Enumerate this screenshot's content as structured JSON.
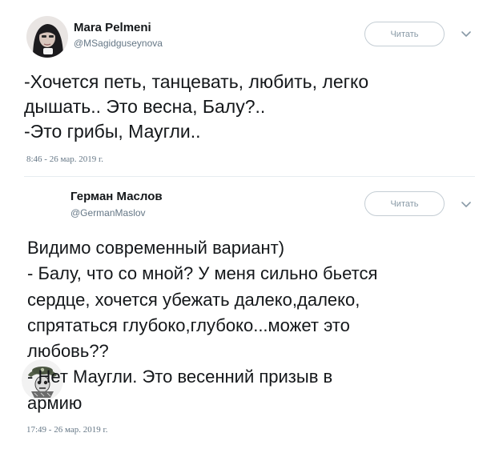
{
  "tweets": [
    {
      "display_name": "Mara Pelmeni",
      "handle": "@MSagidguseynova",
      "follow_label": "Читать",
      "text": "-Хочется петь, танцевать, любить, легко\nдышать.. Это весна, Балу?..\n-Это грибы, Маугли..",
      "timestamp": "8:46 - 26 мар. 2019 г."
    },
    {
      "display_name": "Герман Маслов",
      "handle": "@GermanMaslov",
      "follow_label": "Читать",
      "text": "Видимо современный вариант)\n- Балу, что со мной? У меня сильно бьется\nсердце, хочется убежать далеко,далеко,\nспрятаться глубоко,глубоко...может это\nлюбовь??\n- Нет Маугли. Это весенний призыв в\nармию",
      "timestamp": "17:49 - 26 мар. 2019 г."
    }
  ],
  "icons": {
    "avatar_1": "avatar-photo",
    "avatar_2": "avatar-emblem",
    "caret": "chevron-down-icon"
  },
  "colors": {
    "text": "#14171a",
    "muted": "#657786",
    "button_border": "#c4cdd4",
    "divider": "#e6ecf0"
  }
}
